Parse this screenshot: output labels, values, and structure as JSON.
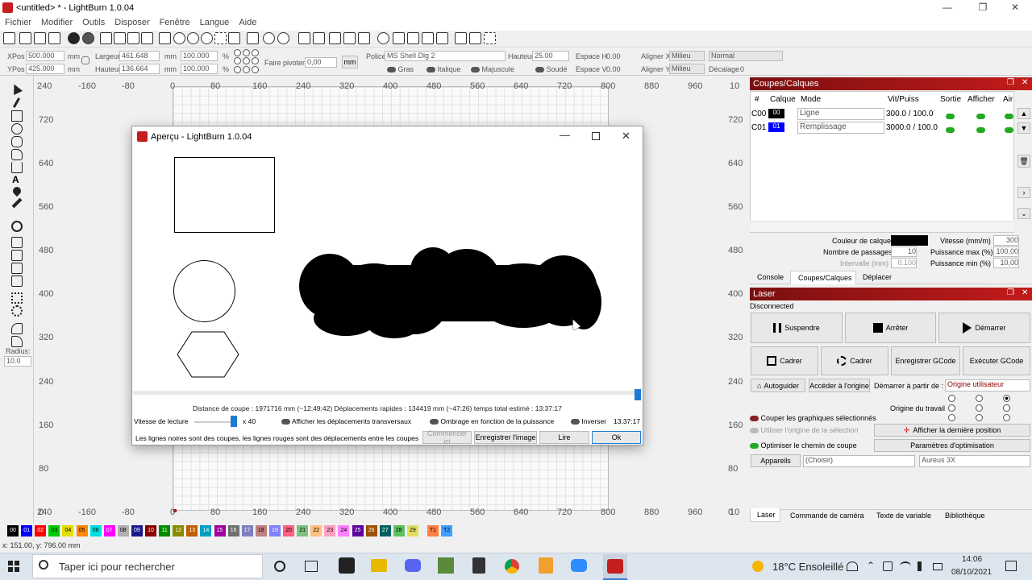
{
  "window": {
    "title": "<untitled> * - LightBurn 1.0.04",
    "minimize": "—",
    "maximize": "❐",
    "close": "✕"
  },
  "menu": [
    "Fichier",
    "Modifier",
    "Outils",
    "Disposer",
    "Fenêtre",
    "Langue",
    "Aide"
  ],
  "props": {
    "xpos_label": "XPos",
    "xpos": "500.000",
    "ypos_label": "YPos",
    "ypos": "425.000",
    "mm": "mm",
    "width_label": "Largeur",
    "width": "461.648",
    "height_label": "Hauteur",
    "height": "136.664",
    "pct1": "100.000",
    "pct2": "100.000",
    "percent": "%",
    "rotate_label": "Faire pivoter",
    "rotate": "0,00",
    "mm_btn": "mm",
    "font_label": "Police",
    "font": "MS Shell Dlg 2",
    "height2_label": "Hauteur",
    "height2": "25.00",
    "spaceh_label": "Espace H",
    "spaceh": "0.00",
    "spacev_label": "Espace V",
    "spacev": "0.00",
    "alignx_label": "Aligner X",
    "alignx": "Milieu",
    "aligny_label": "Aligner Y",
    "aligny": "Milieu",
    "normal": "Normal",
    "offset_label": "Décalage",
    "offset": "0",
    "bold": "Gras",
    "italic": "Italique",
    "caps": "Majuscule",
    "welded": "Soudé"
  },
  "rulers": {
    "top": [
      "240",
      "-160",
      "-80",
      "0",
      "80",
      "160",
      "240",
      "320",
      "400",
      "480",
      "560",
      "640",
      "720",
      "800",
      "880",
      "960",
      "10"
    ],
    "bottom": [
      "240",
      "-160",
      "-80",
      "0",
      "80",
      "160",
      "240",
      "320",
      "400",
      "480",
      "560",
      "640",
      "720",
      "800",
      "880",
      "960",
      "10"
    ],
    "left": [
      "720",
      "640",
      "560",
      "480",
      "400",
      "320",
      "240",
      "160",
      "80",
      "0"
    ],
    "right": [
      "720",
      "640",
      "560",
      "480",
      "400",
      "320",
      "240",
      "160",
      "80",
      "0"
    ]
  },
  "radius": {
    "label": "Radius:",
    "value": "10.0"
  },
  "dialog": {
    "title": "Aperçu - LightBurn 1.0.04",
    "stats": "Distance de coupe : 1971716 mm (~12:49:42)   Déplacements rapides : 134419 mm (~47:26)   temps total estimé : 13:37:17",
    "speed_label": "Vitesse de lecture",
    "speed_value": "x 40",
    "show_moves": "Afficher les déplacements transversaux",
    "shading": "Ombrage en fonction de la puissance",
    "invert": "Inverser",
    "time": "13:37:17",
    "legend": "Les lignes noires sont des coupes, les lignes rouges sont des déplacements entre les coupes",
    "start_here": "Commencer ici",
    "save_image": "Enregistrer l'image",
    "play": "Lire",
    "ok": "Ok"
  },
  "cuts": {
    "title": "Coupes/Calques",
    "headers": [
      "#",
      "Calque",
      "Mode",
      "Vit/Puiss",
      "Sortie",
      "Afficher",
      "Air"
    ],
    "rows": [
      {
        "id": "C00",
        "layer": "00",
        "color": "#000000",
        "mode": "Ligne",
        "speed": "300.0 / 100.0"
      },
      {
        "id": "C01",
        "layer": "01",
        "color": "#0000ff",
        "mode": "Remplissage",
        "speed": "3000.0 / 100.0"
      }
    ],
    "layer_color_label": "Couleur de calque",
    "layer_color": "#000000",
    "speed_label": "Vitesse (mm/m)",
    "speed": "300",
    "passes_label": "Nombre de passages",
    "passes": "10",
    "pmax_label": "Puissance max (%)",
    "pmax": "100,00",
    "interval_label": "Intervalle (mm)",
    "interval": "0.100",
    "pmin_label": "Puissance min (%)",
    "pmin": "10,00",
    "tabs": [
      "Console",
      "Coupes/Calques",
      "Déplacer"
    ]
  },
  "laser": {
    "title": "Laser",
    "status": "Disconnected",
    "pause": "Suspendre",
    "stop": "Arrêter",
    "start": "Démarrer",
    "frame1": "Cadrer",
    "frame2": "Cadrer",
    "save_gcode": "Enregistrer GCode",
    "run_gcode": "Exécuter GCode",
    "home": "Autoguider",
    "goto_origin": "Accéder à l'origine",
    "start_from_label": "Démarrer à partir de :",
    "start_from": "Origine utilisateur",
    "job_origin_label": "Origine du travail",
    "cut_selected": "Couper les graphiques sélectionnés",
    "use_selection_origin": "Utiliser l'origine de la sélection",
    "show_last_pos": "Afficher la dernière position",
    "optimize": "Optimiser le chemin de coupe",
    "opt_settings": "Paramètres d'optimisation",
    "devices": "Appareils",
    "choose": "(Choisir)",
    "device": "Aureus 3X",
    "tabs": [
      "Laser",
      "Commande de caméra",
      "Texte de variable",
      "Bibliothèque"
    ]
  },
  "palette": [
    {
      "n": "00",
      "c": "#000000",
      "t": "#fff"
    },
    {
      "n": "01",
      "c": "#0000ff",
      "t": "#fff"
    },
    {
      "n": "02",
      "c": "#ff0000",
      "t": "#fff"
    },
    {
      "n": "03",
      "c": "#00cc00",
      "t": "#000"
    },
    {
      "n": "04",
      "c": "#e0e000",
      "t": "#000"
    },
    {
      "n": "05",
      "c": "#ff8800",
      "t": "#000"
    },
    {
      "n": "06",
      "c": "#00e0e0",
      "t": "#000"
    },
    {
      "n": "07",
      "c": "#ff00ff",
      "t": "#fff"
    },
    {
      "n": "08",
      "c": "#b0b0b0",
      "t": "#000"
    },
    {
      "n": "09",
      "c": "#1a1a8a",
      "t": "#fff"
    },
    {
      "n": "10",
      "c": "#8a0000",
      "t": "#fff"
    },
    {
      "n": "11",
      "c": "#008a00",
      "t": "#fff"
    },
    {
      "n": "12",
      "c": "#8a8a00",
      "t": "#fff"
    },
    {
      "n": "13",
      "c": "#c06000",
      "t": "#fff"
    },
    {
      "n": "14",
      "c": "#00a0c0",
      "t": "#fff"
    },
    {
      "n": "15",
      "c": "#a000a0",
      "t": "#fff"
    },
    {
      "n": "16",
      "c": "#707070",
      "t": "#fff"
    },
    {
      "n": "17",
      "c": "#8080c0",
      "t": "#fff"
    },
    {
      "n": "18",
      "c": "#c08080",
      "t": "#000"
    },
    {
      "n": "19",
      "c": "#8080ff",
      "t": "#fff"
    },
    {
      "n": "20",
      "c": "#ff6080",
      "t": "#000"
    },
    {
      "n": "21",
      "c": "#80c080",
      "t": "#000"
    },
    {
      "n": "22",
      "c": "#ffc080",
      "t": "#000"
    },
    {
      "n": "23",
      "c": "#ffa0c0",
      "t": "#000"
    },
    {
      "n": "24",
      "c": "#ff80ff",
      "t": "#000"
    },
    {
      "n": "25",
      "c": "#6000a0",
      "t": "#fff"
    },
    {
      "n": "26",
      "c": "#a05000",
      "t": "#fff"
    },
    {
      "n": "27",
      "c": "#006060",
      "t": "#fff"
    },
    {
      "n": "28",
      "c": "#60c060",
      "t": "#000"
    },
    {
      "n": "29",
      "c": "#e0e060",
      "t": "#000"
    },
    {
      "n": "T1",
      "c": "#ff8040",
      "t": "#000"
    },
    {
      "n": "T2",
      "c": "#40a0ff",
      "t": "#000"
    }
  ],
  "status": {
    "coords": "x: 151.00, y: 796.00 mm"
  },
  "taskbar": {
    "search": "Taper ici pour rechercher",
    "weather": "18°C Ensoleillé",
    "time": "14:06",
    "date": "08/10/2021"
  }
}
